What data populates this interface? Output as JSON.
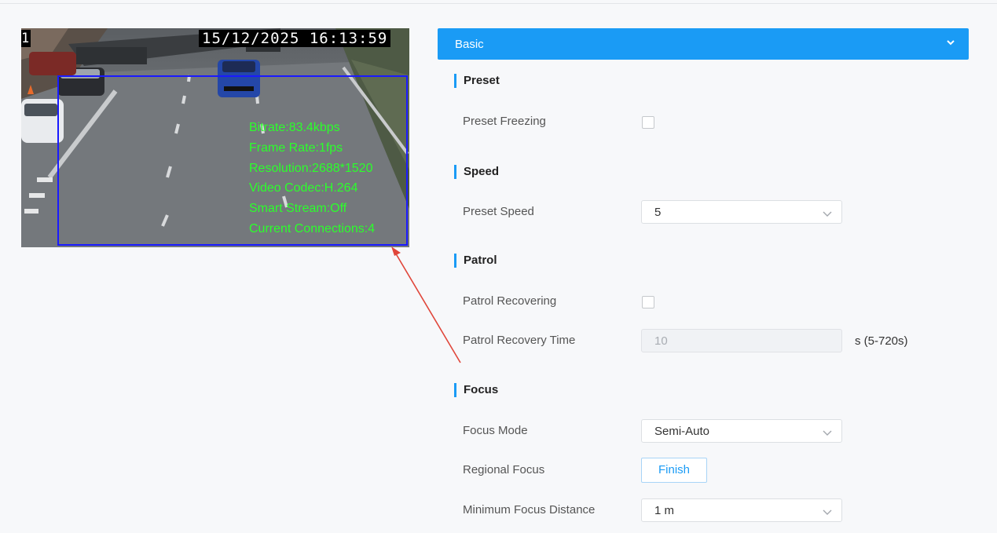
{
  "video": {
    "channel": "1",
    "timestamp": "15/12/2025 16:13:59",
    "overlay": [
      "Bitrate:83.4kbps",
      "Frame Rate:1fps",
      "Resolution:2688*1520",
      "Video Codec:H.264",
      "Smart Stream:Off",
      "Current Connections:4"
    ]
  },
  "panel": {
    "title": "Basic",
    "accent_color": "#1a9bf5"
  },
  "preset": {
    "heading": "Preset",
    "freezing_label": "Preset Freezing",
    "freezing_checked": false
  },
  "speed": {
    "heading": "Speed",
    "preset_speed_label": "Preset Speed",
    "preset_speed_value": "5"
  },
  "patrol": {
    "heading": "Patrol",
    "recovering_label": "Patrol Recovering",
    "recovering_checked": false,
    "recovery_time_label": "Patrol Recovery Time",
    "recovery_time_value": "10",
    "recovery_time_unit": "s (5-720s)"
  },
  "focus": {
    "heading": "Focus",
    "mode_label": "Focus Mode",
    "mode_value": "Semi-Auto",
    "regional_label": "Regional Focus",
    "finish_button": "Finish",
    "min_distance_label": "Minimum Focus Distance",
    "min_distance_value": "1 m"
  }
}
